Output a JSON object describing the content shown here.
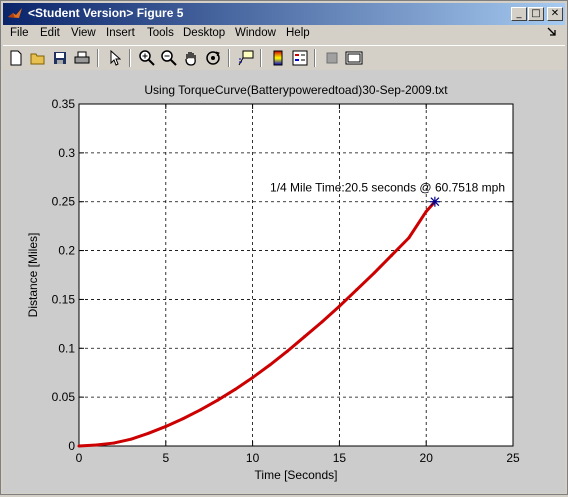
{
  "window": {
    "title": "<Student Version> Figure 5",
    "controls": {
      "minimize": "_",
      "maximize": "□",
      "close": "✕"
    }
  },
  "menubar": {
    "items": [
      {
        "label": "File"
      },
      {
        "label": "Edit"
      },
      {
        "label": "View"
      },
      {
        "label": "Insert"
      },
      {
        "label": "Tools"
      },
      {
        "label": "Desktop"
      },
      {
        "label": "Window"
      },
      {
        "label": "Help"
      }
    ],
    "dock_icon": "dock-arrow-icon"
  },
  "toolbar": {
    "buttons": [
      "new-figure-icon",
      "open-file-icon",
      "save-icon",
      "print-icon",
      "edit-plot-arrow-icon",
      "zoom-in-icon",
      "zoom-out-icon",
      "pan-hand-icon",
      "rotate-3d-icon",
      "data-cursor-icon",
      "colorbar-icon",
      "legend-icon",
      "hide-plot-tools-icon",
      "show-plot-tools-icon"
    ]
  },
  "colors": {
    "line": "#cc0000",
    "marker": "#00008b",
    "axes_bg": "#ffffff",
    "figure_bg": "#cccccc"
  },
  "chart_data": {
    "type": "line",
    "title": "Using TorqueCurve(Batterypoweredtoad)30-Sep-2009.txt",
    "xlabel": "Time [Seconds]",
    "ylabel": "Distance [Miles]",
    "xlim": [
      0,
      25
    ],
    "ylim": [
      0,
      0.35
    ],
    "xticks": [
      0,
      5,
      10,
      15,
      20,
      25
    ],
    "yticks": [
      0,
      0.05,
      0.1,
      0.15,
      0.2,
      0.25,
      0.3,
      0.35
    ],
    "xtick_labels": [
      "0",
      "5",
      "10",
      "15",
      "20",
      "25"
    ],
    "ytick_labels": [
      "0",
      "0.05",
      "0.1",
      "0.15",
      "0.2",
      "0.25",
      "0.3",
      "0.35"
    ],
    "grid": true,
    "grid_style": "dashed",
    "series": [
      {
        "x": [
          0,
          1,
          2,
          3,
          4,
          5,
          6,
          7,
          8,
          9,
          10,
          11,
          12,
          13,
          14,
          15,
          16,
          17,
          18,
          19,
          20,
          20.5
        ],
        "y": [
          0,
          0.001,
          0.003,
          0.007,
          0.013,
          0.02,
          0.028,
          0.037,
          0.047,
          0.058,
          0.07,
          0.083,
          0.097,
          0.112,
          0.127,
          0.143,
          0.16,
          0.177,
          0.195,
          0.213,
          0.24,
          0.25
        ]
      }
    ],
    "highlight_point": {
      "x": 20.5,
      "y": 0.25,
      "marker": "*"
    },
    "annotation": {
      "text": "1/4 Mile Time:20.5 seconds @ 60.7518 mph",
      "x": 20.5,
      "y": 0.25
    }
  }
}
